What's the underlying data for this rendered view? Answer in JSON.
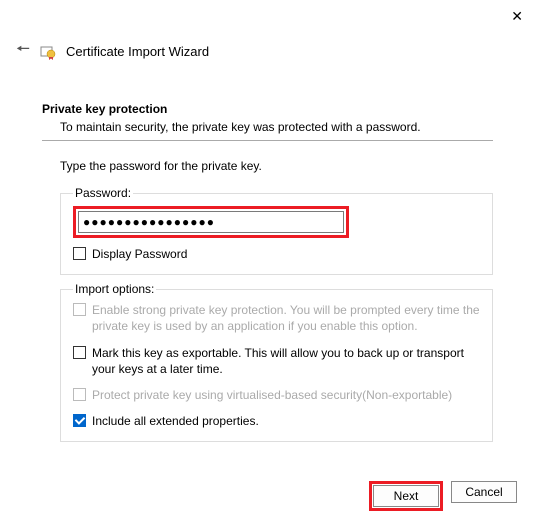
{
  "window": {
    "title": "Certificate Import Wizard"
  },
  "section": {
    "header": "Private key protection",
    "desc": "To maintain security, the private key was protected with a password."
  },
  "instruction": "Type the password for the private key.",
  "password_group": {
    "legend": "Password:",
    "value": "●●●●●●●●●●●●●●●●",
    "display_label": "Display Password"
  },
  "options_group": {
    "legend": "Import options:",
    "opt_strong": "Enable strong private key protection. You will be prompted every time the private key is used by an application if you enable this option.",
    "opt_exportable": "Mark this key as exportable. This will allow you to back up or transport your keys at a later time.",
    "opt_virtualised": "Protect private key using virtualised-based security(Non-exportable)",
    "opt_extended": "Include all extended properties."
  },
  "buttons": {
    "next": "Next",
    "cancel": "Cancel"
  }
}
